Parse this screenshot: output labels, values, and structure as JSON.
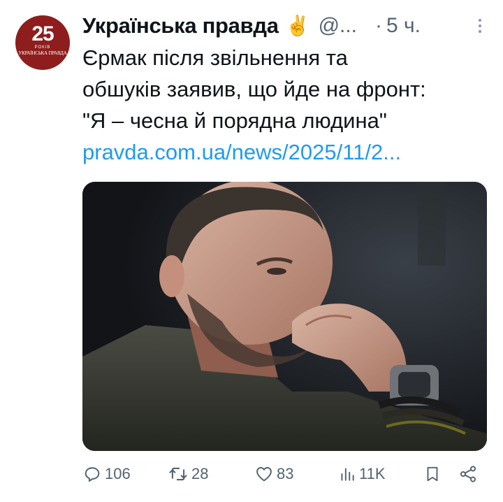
{
  "account": {
    "display_name": "Українська правда",
    "emoji": "✌️",
    "handle": "@...",
    "separator": "·",
    "time": "5 ч.",
    "avatar": {
      "number": "25",
      "years": "РОКІВ",
      "brand": "УКРАЇНСЬКА ПРАВДА"
    }
  },
  "tweet": {
    "lines": [
      "Єрмак після звільнення та",
      "обшуків заявив, що йде на фронт:",
      "\"Я – чесна й порядна людина\""
    ],
    "link": "pravda.com.ua/news/2025/11/2..."
  },
  "actions": {
    "replies": "106",
    "retweets": "28",
    "likes": "83",
    "views": "11K"
  },
  "colors": {
    "link": "#1d9bf0",
    "secondary_text": "#536471",
    "avatar_bg": "#8e1d1d"
  }
}
